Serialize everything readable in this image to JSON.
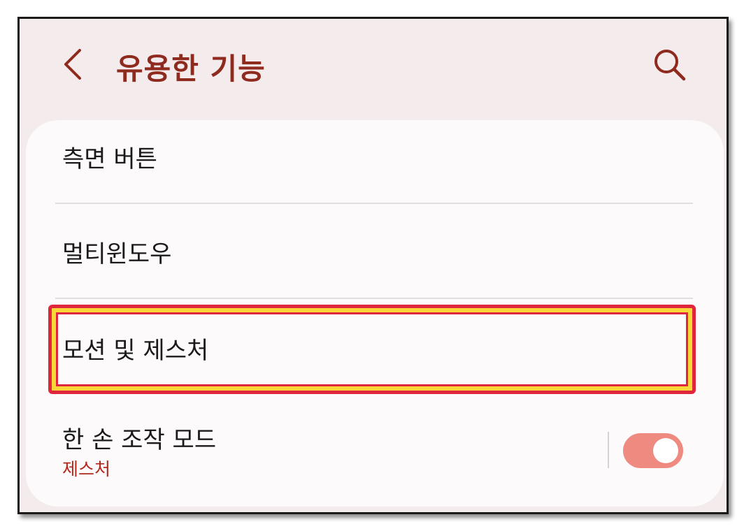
{
  "header": {
    "title": "유용한 기능",
    "back_icon": "chevron-left-icon",
    "search_icon": "search-icon"
  },
  "list": {
    "items": [
      {
        "label": "측면 버튼"
      },
      {
        "label": "멀티윈도우"
      },
      {
        "label": "모션 및 제스처",
        "highlighted": true
      },
      {
        "label": "한 손 조작 모드",
        "sublabel": "제스처",
        "toggle_on": true
      }
    ]
  },
  "colors": {
    "accent": "#8e2a1e",
    "sublabel": "#b5261b",
    "toggle_on": "#ee8a80",
    "highlight_border": "#e0263a",
    "highlight_fill": "#f7d73a",
    "background": "#f4ecec"
  }
}
